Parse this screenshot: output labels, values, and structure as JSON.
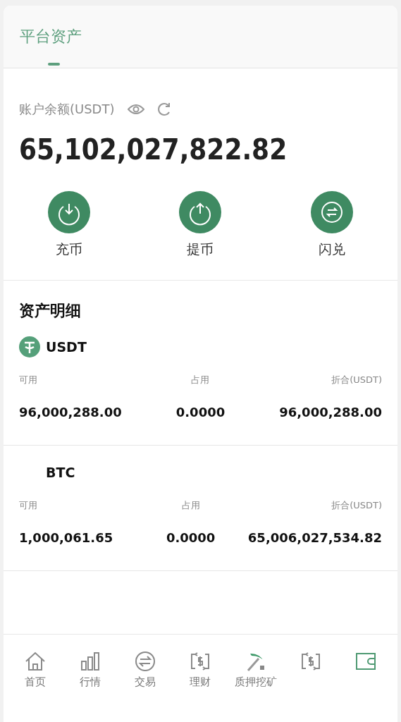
{
  "header": {
    "title": "平台资产"
  },
  "balance": {
    "label": "账户余额(USDT)",
    "amount": "65,102,027,822.82"
  },
  "actions": [
    {
      "kind": "deposit",
      "label": "充币"
    },
    {
      "kind": "withdraw",
      "label": "提币"
    },
    {
      "kind": "swap",
      "label": "闪兑"
    }
  ],
  "assets": {
    "title": "资产明细",
    "items": [
      {
        "symbol": "USDT",
        "has_icon": true,
        "columns": [
          "可用",
          "占用",
          "折合(USDT)"
        ],
        "values": [
          "96,000,288.00",
          "0.0000",
          "96,000,288.00"
        ]
      },
      {
        "symbol": "BTC",
        "has_icon": false,
        "columns": [
          "可用",
          "占用",
          "折合(USDT)"
        ],
        "values": [
          "1,000,061.65",
          "0.0000",
          "65,006,027,534.82"
        ]
      }
    ]
  },
  "tab_bar": [
    {
      "kind": "home",
      "label": "首页",
      "selected": false
    },
    {
      "kind": "chart",
      "label": "行情",
      "selected": false
    },
    {
      "kind": "exchange",
      "label": "交易",
      "selected": false
    },
    {
      "kind": "finance",
      "label": "理财",
      "selected": false
    },
    {
      "kind": "mining",
      "label": "质押挖矿",
      "selected": false
    },
    {
      "kind": "finance",
      "selected": false
    },
    {
      "kind": "wallet",
      "selected": true
    }
  ]
}
